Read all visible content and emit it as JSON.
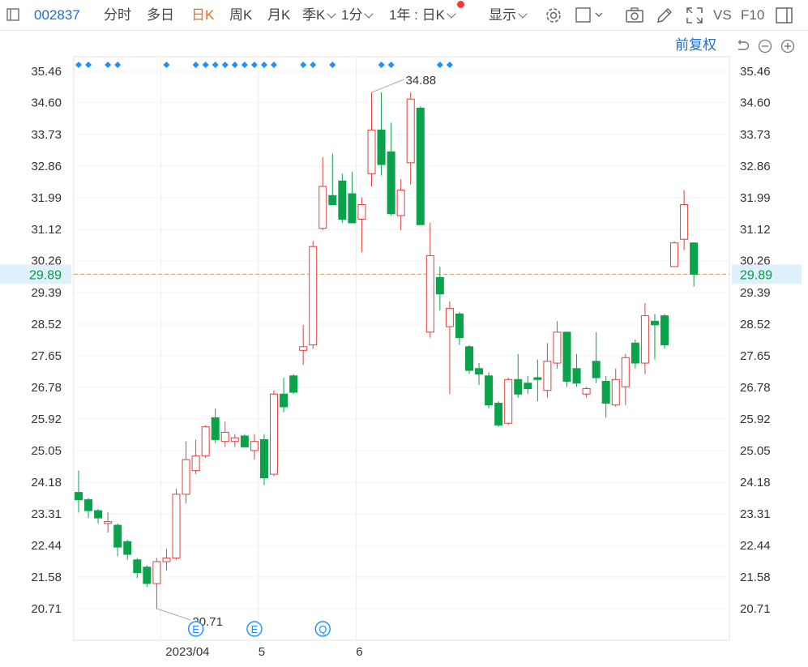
{
  "toolbar": {
    "stock_code": "002837",
    "tabs": [
      {
        "label": "分时",
        "active": false
      },
      {
        "label": "多日",
        "active": false
      },
      {
        "label": "日K",
        "active": true
      },
      {
        "label": "周K",
        "active": false
      },
      {
        "label": "月K",
        "active": false
      },
      {
        "label": "季K",
        "active": false
      },
      {
        "label": "1分",
        "active": false
      }
    ],
    "range_select": "1年 : 日K",
    "display_label": "显示",
    "vs_label": "VS",
    "f10_label": "F10"
  },
  "subbar": {
    "adjust_label": "前复权"
  },
  "chart_data": {
    "type": "candlestick",
    "ylim": [
      20.71,
      35.46
    ],
    "y_ticks": [
      "35.46",
      "34.60",
      "33.73",
      "32.86",
      "31.99",
      "31.12",
      "30.26",
      "29.39",
      "28.52",
      "27.65",
      "26.78",
      "25.92",
      "25.05",
      "24.18",
      "23.31",
      "22.44",
      "21.58",
      "20.71"
    ],
    "x_ticks": [
      {
        "label": "2023/04",
        "index": 9
      },
      {
        "label": "5",
        "index": 19
      },
      {
        "label": "6",
        "index": 29
      }
    ],
    "current_price": "29.89",
    "max_label": "34.88",
    "min_label": "20.71",
    "event_markers": [
      {
        "label": "E",
        "index": 12
      },
      {
        "label": "E",
        "index": 18
      },
      {
        "label": "Q",
        "index": 25
      }
    ],
    "signal_dot_indices": [
      0,
      1,
      3,
      4,
      9,
      12,
      13,
      14,
      15,
      16,
      17,
      18,
      19,
      20,
      23,
      24,
      26,
      31,
      32,
      37,
      38
    ],
    "candles": [
      {
        "o": 23.9,
        "h": 24.5,
        "l": 23.35,
        "c": 23.7
      },
      {
        "o": 23.7,
        "h": 23.75,
        "l": 23.2,
        "c": 23.4
      },
      {
        "o": 23.4,
        "h": 23.45,
        "l": 23.05,
        "c": 23.2
      },
      {
        "o": 23.05,
        "h": 23.35,
        "l": 22.8,
        "c": 23.1
      },
      {
        "o": 23.0,
        "h": 23.05,
        "l": 22.15,
        "c": 22.4
      },
      {
        "o": 22.55,
        "h": 22.6,
        "l": 22.05,
        "c": 22.2
      },
      {
        "o": 22.05,
        "h": 22.1,
        "l": 21.55,
        "c": 21.7
      },
      {
        "o": 21.85,
        "h": 21.9,
        "l": 21.3,
        "c": 21.4
      },
      {
        "o": 21.4,
        "h": 22.1,
        "l": 20.71,
        "c": 22.0
      },
      {
        "o": 22.0,
        "h": 22.35,
        "l": 21.75,
        "c": 22.1
      },
      {
        "o": 22.1,
        "h": 24.0,
        "l": 22.05,
        "c": 23.85
      },
      {
        "o": 23.85,
        "h": 25.3,
        "l": 23.6,
        "c": 24.8
      },
      {
        "o": 24.5,
        "h": 25.35,
        "l": 24.4,
        "c": 24.9
      },
      {
        "o": 24.9,
        "h": 25.75,
        "l": 24.85,
        "c": 25.7
      },
      {
        "o": 25.95,
        "h": 26.2,
        "l": 25.25,
        "c": 25.35
      },
      {
        "o": 25.3,
        "h": 25.85,
        "l": 25.15,
        "c": 25.55
      },
      {
        "o": 25.3,
        "h": 25.5,
        "l": 25.15,
        "c": 25.4
      },
      {
        "o": 25.45,
        "h": 25.5,
        "l": 25.15,
        "c": 25.15
      },
      {
        "o": 25.05,
        "h": 25.5,
        "l": 24.8,
        "c": 25.3
      },
      {
        "o": 25.35,
        "h": 25.5,
        "l": 24.1,
        "c": 24.3
      },
      {
        "o": 24.4,
        "h": 26.7,
        "l": 24.35,
        "c": 26.6
      },
      {
        "o": 26.6,
        "h": 27.05,
        "l": 26.1,
        "c": 26.25
      },
      {
        "o": 27.1,
        "h": 27.15,
        "l": 26.6,
        "c": 26.65
      },
      {
        "o": 27.8,
        "h": 28.5,
        "l": 27.4,
        "c": 27.9
      },
      {
        "o": 27.95,
        "h": 30.8,
        "l": 27.85,
        "c": 30.65
      },
      {
        "o": 31.15,
        "h": 33.1,
        "l": 31.1,
        "c": 32.3
      },
      {
        "o": 32.05,
        "h": 33.2,
        "l": 31.8,
        "c": 31.8
      },
      {
        "o": 32.45,
        "h": 32.65,
        "l": 31.3,
        "c": 31.4
      },
      {
        "o": 32.1,
        "h": 32.7,
        "l": 31.3,
        "c": 31.3
      },
      {
        "o": 31.4,
        "h": 32.0,
        "l": 30.5,
        "c": 31.8
      },
      {
        "o": 32.65,
        "h": 34.88,
        "l": 32.3,
        "c": 33.85
      },
      {
        "o": 33.85,
        "h": 34.88,
        "l": 32.6,
        "c": 32.9
      },
      {
        "o": 33.25,
        "h": 34.05,
        "l": 31.5,
        "c": 31.55
      },
      {
        "o": 31.5,
        "h": 32.5,
        "l": 31.1,
        "c": 32.2
      },
      {
        "o": 32.95,
        "h": 34.88,
        "l": 32.35,
        "c": 34.7
      },
      {
        "o": 34.45,
        "h": 34.5,
        "l": 31.25,
        "c": 31.25
      },
      {
        "o": 28.3,
        "h": 31.3,
        "l": 28.15,
        "c": 30.4
      },
      {
        "o": 29.8,
        "h": 30.1,
        "l": 28.9,
        "c": 29.35
      },
      {
        "o": 28.45,
        "h": 29.15,
        "l": 26.6,
        "c": 28.95
      },
      {
        "o": 28.8,
        "h": 28.85,
        "l": 27.95,
        "c": 28.15
      },
      {
        "o": 27.9,
        "h": 27.95,
        "l": 27.15,
        "c": 27.25
      },
      {
        "o": 27.3,
        "h": 27.45,
        "l": 26.85,
        "c": 27.15
      },
      {
        "o": 27.1,
        "h": 27.2,
        "l": 26.2,
        "c": 26.3
      },
      {
        "o": 26.35,
        "h": 26.4,
        "l": 25.7,
        "c": 25.75
      },
      {
        "o": 25.8,
        "h": 27.05,
        "l": 25.75,
        "c": 27.0
      },
      {
        "o": 27.0,
        "h": 27.7,
        "l": 26.5,
        "c": 26.6
      },
      {
        "o": 26.9,
        "h": 27.1,
        "l": 26.6,
        "c": 26.75
      },
      {
        "o": 27.05,
        "h": 27.55,
        "l": 26.4,
        "c": 27.0
      },
      {
        "o": 26.7,
        "h": 28.0,
        "l": 26.5,
        "c": 27.5
      },
      {
        "o": 27.45,
        "h": 28.6,
        "l": 27.3,
        "c": 28.3
      },
      {
        "o": 28.3,
        "h": 28.3,
        "l": 26.8,
        "c": 26.95
      },
      {
        "o": 27.3,
        "h": 27.7,
        "l": 26.8,
        "c": 26.9
      },
      {
        "o": 26.6,
        "h": 26.8,
        "l": 26.5,
        "c": 26.75
      },
      {
        "o": 27.5,
        "h": 28.3,
        "l": 26.9,
        "c": 27.05
      },
      {
        "o": 26.95,
        "h": 27.1,
        "l": 25.95,
        "c": 26.35
      },
      {
        "o": 26.3,
        "h": 27.3,
        "l": 26.25,
        "c": 27.0
      },
      {
        "o": 26.8,
        "h": 27.7,
        "l": 26.3,
        "c": 27.6
      },
      {
        "o": 28.0,
        "h": 28.1,
        "l": 27.3,
        "c": 27.45
      },
      {
        "o": 27.45,
        "h": 29.1,
        "l": 27.15,
        "c": 28.75
      },
      {
        "o": 28.6,
        "h": 28.8,
        "l": 27.55,
        "c": 28.5
      },
      {
        "o": 28.75,
        "h": 28.8,
        "l": 27.85,
        "c": 27.95
      },
      {
        "o": 30.1,
        "h": 30.8,
        "l": 30.1,
        "c": 30.75
      },
      {
        "o": 30.85,
        "h": 32.2,
        "l": 30.55,
        "c": 31.8
      },
      {
        "o": 30.75,
        "h": 30.75,
        "l": 29.55,
        "c": 29.89
      }
    ]
  }
}
